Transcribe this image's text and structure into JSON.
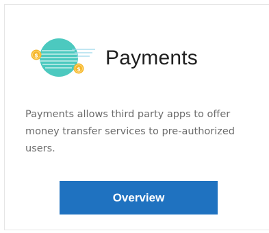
{
  "card": {
    "icon": "payments-coins-icon",
    "title": "Payments",
    "description": "Payments allows third party apps to offer money transfer services to pre-authorized users.",
    "button_label": "Overview"
  },
  "colors": {
    "button_bg": "#1f72c0",
    "button_text": "#ffffff",
    "icon_circle": "#4cc9bf",
    "coin": "#f5b62a",
    "title_text": "#1f1f1f",
    "description_text": "#6b6b6b"
  }
}
